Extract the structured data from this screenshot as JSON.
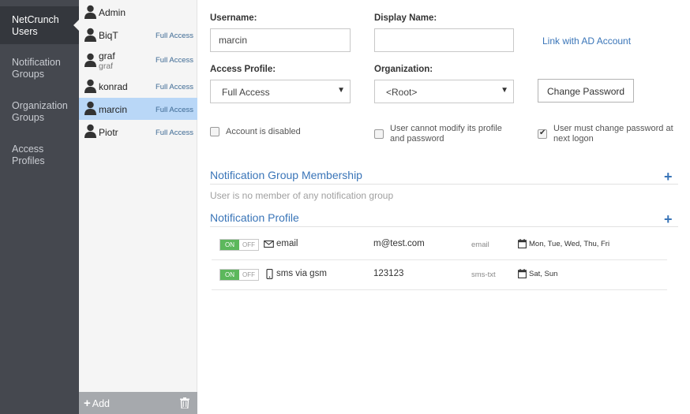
{
  "nav": {
    "items": [
      {
        "line1": "NetCrunch",
        "line2": "Users"
      },
      {
        "line1": "Notification",
        "line2": "Groups"
      },
      {
        "line1": "Organization",
        "line2": "Groups"
      },
      {
        "line1": "Access",
        "line2": "Profiles"
      }
    ]
  },
  "users": [
    {
      "name": "Admin",
      "sub": "",
      "role": ""
    },
    {
      "name": "BiqT",
      "sub": "",
      "role": "Full Access"
    },
    {
      "name": "graf",
      "sub": "graf",
      "role": "Full Access"
    },
    {
      "name": "konrad",
      "sub": "",
      "role": "Full Access"
    },
    {
      "name": "marcin",
      "sub": "",
      "role": "Full Access"
    },
    {
      "name": "Piotr",
      "sub": "",
      "role": "Full Access"
    }
  ],
  "footer": {
    "add_label": "Add"
  },
  "form": {
    "username_label": "Username:",
    "username_value": "marcin",
    "display_name_label": "Display Name:",
    "display_name_value": "",
    "link_ad": "Link with AD Account",
    "access_profile_label": "Access Profile:",
    "access_profile_value": "Full Access",
    "organization_label": "Organization:",
    "organization_value": "<Root>",
    "change_password": "Change Password",
    "chk_disabled": {
      "label": "Account is disabled",
      "checked": false
    },
    "chk_cannot_modify": {
      "line1": "User cannot modify its profile",
      "line2": "and password",
      "checked": false
    },
    "chk_must_change": {
      "line1": "User must change password at",
      "line2": "next logon",
      "checked": true
    }
  },
  "membership": {
    "title": "Notification Group Membership",
    "empty": "User is no member of any notification group"
  },
  "profile": {
    "title": "Notification Profile",
    "rows": [
      {
        "on": "ON",
        "off": "OFF",
        "icon": "envelope-icon",
        "name": "email",
        "address": "m@test.com",
        "type": "email",
        "days": "Mon, Tue, Wed, Thu, Fri"
      },
      {
        "on": "ON",
        "off": "OFF",
        "icon": "mobile-icon",
        "name": "sms via gsm",
        "address": "123123",
        "type": "sms-txt",
        "days": "Sat, Sun"
      }
    ]
  },
  "colors": {
    "nav_bg": "#45484f",
    "nav_active": "#34373d",
    "accent": "#3a75b8",
    "selected_row": "#b9d7f7",
    "toggle_on": "#5cb85c"
  }
}
